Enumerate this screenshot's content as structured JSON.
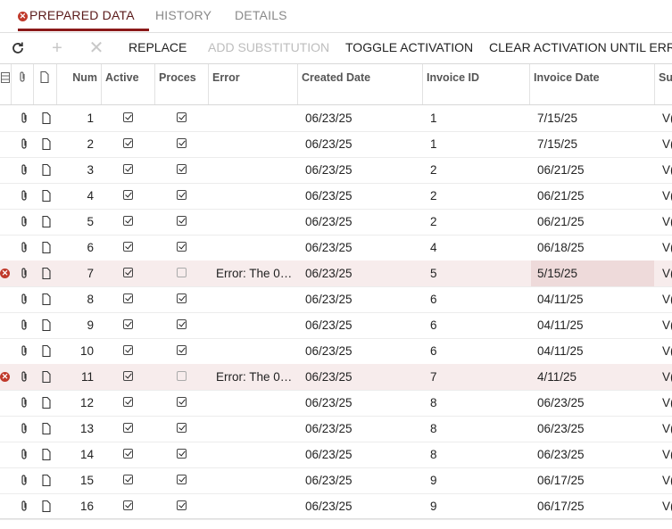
{
  "tabs": [
    {
      "label": "PREPARED DATA"
    },
    {
      "label": "HISTORY"
    },
    {
      "label": "DETAILS"
    }
  ],
  "toolbar": {
    "replace": "REPLACE",
    "add_substitution": "ADD SUBSTITUTION",
    "toggle_activation": "TOGGLE ACTIVATION",
    "clear_activation": "CLEAR ACTIVATION UNTIL ERRO"
  },
  "columns": {
    "num": "Num",
    "active": "Active",
    "processed": "Proces",
    "error": "Error",
    "created_date": "Created Date",
    "invoice_id": "Invoice ID",
    "invoice_date": "Invoice Date",
    "su": "Su"
  },
  "rows": [
    {
      "num": "1",
      "active": true,
      "processed": true,
      "error": "",
      "created": "06/23/25",
      "invoice_id": "1",
      "invoice_date": "7/15/25",
      "su": "V(",
      "has_error": false
    },
    {
      "num": "2",
      "active": true,
      "processed": true,
      "error": "",
      "created": "06/23/25",
      "invoice_id": "1",
      "invoice_date": "7/15/25",
      "su": "V(",
      "has_error": false
    },
    {
      "num": "3",
      "active": true,
      "processed": true,
      "error": "",
      "created": "06/23/25",
      "invoice_id": "2",
      "invoice_date": "06/21/25",
      "su": "V(",
      "has_error": false
    },
    {
      "num": "4",
      "active": true,
      "processed": true,
      "error": "",
      "created": "06/23/25",
      "invoice_id": "2",
      "invoice_date": "06/21/25",
      "su": "V(",
      "has_error": false
    },
    {
      "num": "5",
      "active": true,
      "processed": true,
      "error": "",
      "created": "06/23/25",
      "invoice_id": "2",
      "invoice_date": "06/21/25",
      "su": "V(",
      "has_error": false
    },
    {
      "num": "6",
      "active": true,
      "processed": true,
      "error": "",
      "created": "06/23/25",
      "invoice_id": "4",
      "invoice_date": "06/18/25",
      "su": "V(",
      "has_error": false
    },
    {
      "num": "7",
      "active": true,
      "processed": false,
      "error": "Error: The 0…",
      "created": "06/23/25",
      "invoice_id": "5",
      "invoice_date": "5/15/25",
      "su": "V(",
      "has_error": true,
      "date_highlight": true
    },
    {
      "num": "8",
      "active": true,
      "processed": true,
      "error": "",
      "created": "06/23/25",
      "invoice_id": "6",
      "invoice_date": "04/11/25",
      "su": "V(",
      "has_error": false
    },
    {
      "num": "9",
      "active": true,
      "processed": true,
      "error": "",
      "created": "06/23/25",
      "invoice_id": "6",
      "invoice_date": "04/11/25",
      "su": "V(",
      "has_error": false
    },
    {
      "num": "10",
      "active": true,
      "processed": true,
      "error": "",
      "created": "06/23/25",
      "invoice_id": "6",
      "invoice_date": "04/11/25",
      "su": "V(",
      "has_error": false
    },
    {
      "num": "11",
      "active": true,
      "processed": false,
      "error": "Error: The 0…",
      "created": "06/23/25",
      "invoice_id": "7",
      "invoice_date": "4/11/25",
      "su": "V(",
      "has_error": true
    },
    {
      "num": "12",
      "active": true,
      "processed": true,
      "error": "",
      "created": "06/23/25",
      "invoice_id": "8",
      "invoice_date": "06/23/25",
      "su": "V(",
      "has_error": false
    },
    {
      "num": "13",
      "active": true,
      "processed": true,
      "error": "",
      "created": "06/23/25",
      "invoice_id": "8",
      "invoice_date": "06/23/25",
      "su": "V(",
      "has_error": false
    },
    {
      "num": "14",
      "active": true,
      "processed": true,
      "error": "",
      "created": "06/23/25",
      "invoice_id": "8",
      "invoice_date": "06/23/25",
      "su": "V(",
      "has_error": false
    },
    {
      "num": "15",
      "active": true,
      "processed": true,
      "error": "",
      "created": "06/23/25",
      "invoice_id": "9",
      "invoice_date": "06/17/25",
      "su": "V(",
      "has_error": false
    },
    {
      "num": "16",
      "active": true,
      "processed": true,
      "error": "",
      "created": "06/23/25",
      "invoice_id": "9",
      "invoice_date": "06/17/25",
      "su": "V(",
      "has_error": false
    }
  ],
  "colors": {
    "accent": "#8b1a1a",
    "error": "#c0392b",
    "error_row": "#f7ecec",
    "highlight": "#eedada"
  }
}
